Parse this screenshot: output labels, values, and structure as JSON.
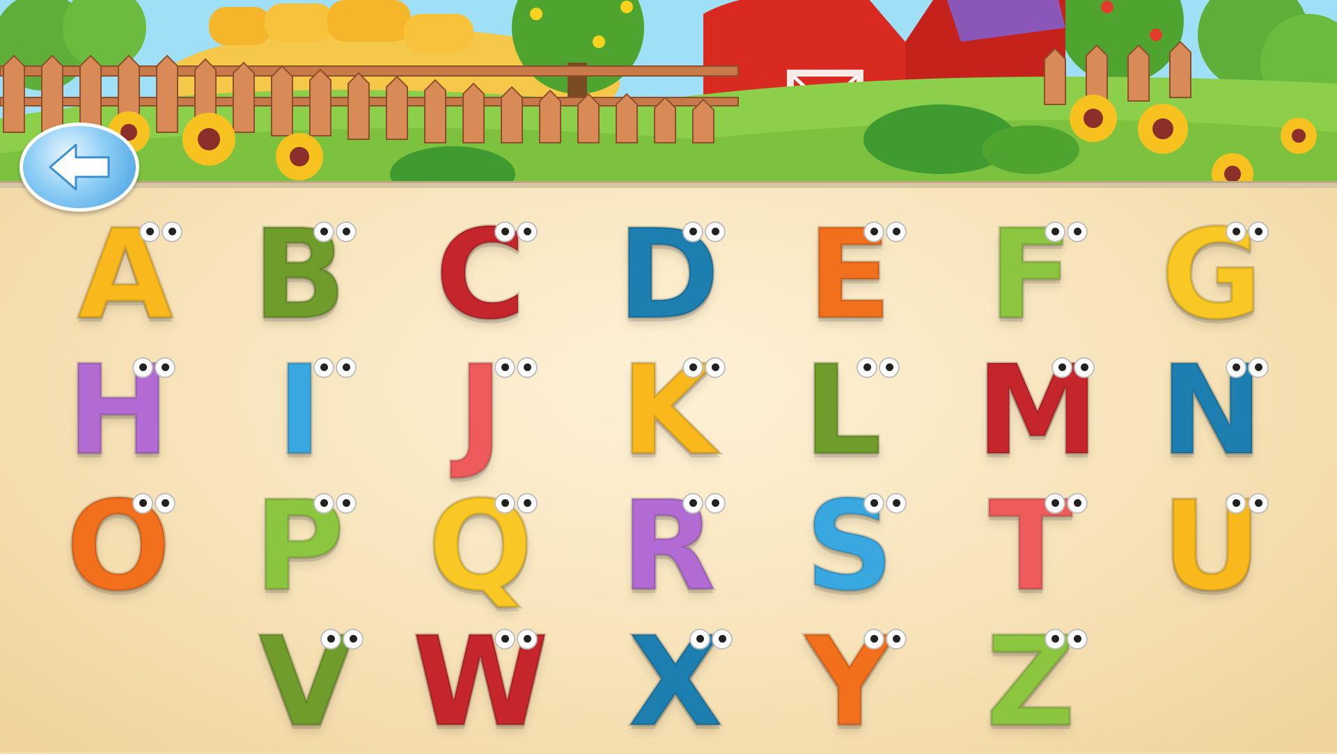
{
  "header": {
    "back_icon": "back-arrow-icon"
  },
  "colors": {
    "sky": "#9fe0f7",
    "grass": "#7cc23f",
    "barn": "#d92a22",
    "board": "#f7e3b8",
    "back_button": "#3f9be0"
  },
  "alphabet": [
    {
      "char": "A",
      "color": "#f9b81c"
    },
    {
      "char": "B",
      "color": "#6f9c2a"
    },
    {
      "char": "C",
      "color": "#c4262c"
    },
    {
      "char": "D",
      "color": "#1c7fb0"
    },
    {
      "char": "E",
      "color": "#f26f1c"
    },
    {
      "char": "F",
      "color": "#8cc63e"
    },
    {
      "char": "G",
      "color": "#f9c824"
    },
    {
      "char": "H",
      "color": "#b36bd4"
    },
    {
      "char": "I",
      "color": "#3aa8e0"
    },
    {
      "char": "J",
      "color": "#ef5b5b"
    },
    {
      "char": "K",
      "color": "#f9b81c"
    },
    {
      "char": "L",
      "color": "#6f9c2a"
    },
    {
      "char": "M",
      "color": "#c4262c"
    },
    {
      "char": "N",
      "color": "#1c7fb0"
    },
    {
      "char": "O",
      "color": "#f26f1c"
    },
    {
      "char": "P",
      "color": "#8cc63e"
    },
    {
      "char": "Q",
      "color": "#f9c824"
    },
    {
      "char": "R",
      "color": "#b36bd4"
    },
    {
      "char": "S",
      "color": "#3aa8e0"
    },
    {
      "char": "T",
      "color": "#ef5b5b"
    },
    {
      "char": "U",
      "color": "#f9b81c"
    },
    {
      "char": "V",
      "color": "#6f9c2a"
    },
    {
      "char": "W",
      "color": "#c4262c"
    },
    {
      "char": "X",
      "color": "#1c7fb0"
    },
    {
      "char": "Y",
      "color": "#f26f1c"
    },
    {
      "char": "Z",
      "color": "#8cc63e"
    }
  ]
}
